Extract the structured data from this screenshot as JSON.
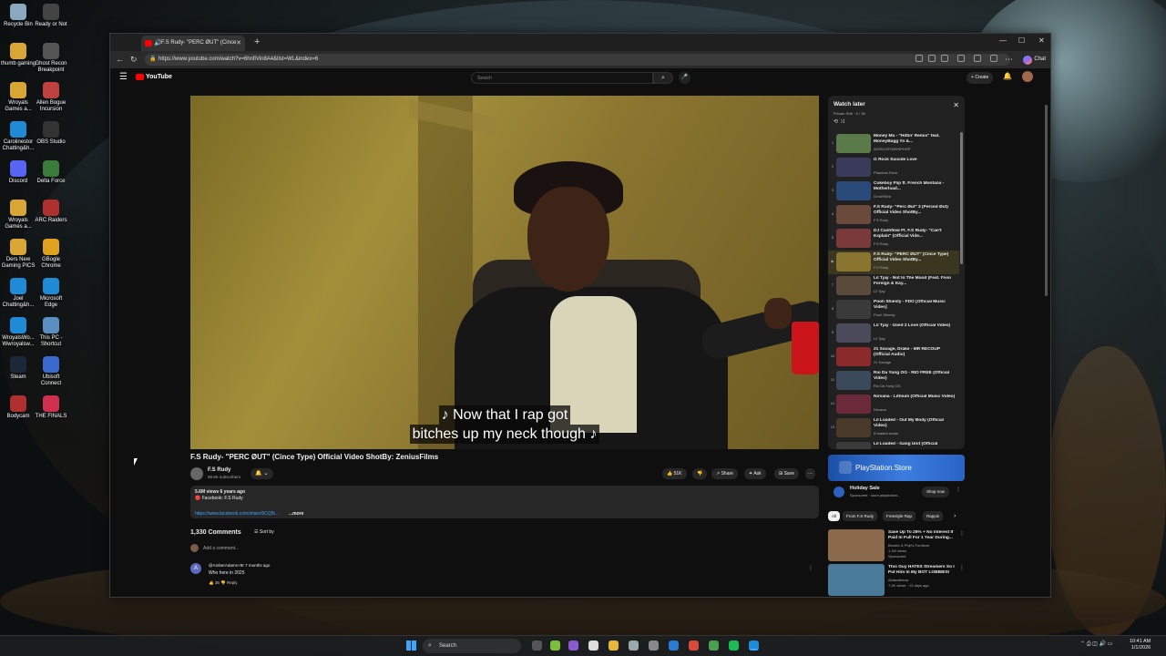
{
  "desktop": {
    "icons": [
      {
        "label": "Recycle Bin",
        "color": "#8aa8c0"
      },
      {
        "label": "Ready or Not",
        "color": "#444"
      },
      {
        "label": "thumb gaming",
        "color": "#d9a534"
      },
      {
        "label": "Ghost Recon Breakpoint",
        "color": "#555"
      },
      {
        "label": "Wroyals Games a...",
        "color": "#d9a534"
      },
      {
        "label": "Allen Bogue Incursion",
        "color": "#c04040"
      },
      {
        "label": "Carolinestor Chatting&h...",
        "color": "#1f8bd6"
      },
      {
        "label": "OBS Studio",
        "color": "#333"
      },
      {
        "label": "Discord",
        "color": "#5865f2"
      },
      {
        "label": "Delta Force",
        "color": "#3a7a3a"
      },
      {
        "label": "Wroyals Games a...",
        "color": "#d9a534"
      },
      {
        "label": "ARC Raiders",
        "color": "#b03030"
      },
      {
        "label": "Ders New Gaming PICS",
        "color": "#d9a534"
      },
      {
        "label": "GBogle Chrome",
        "color": "#e0a020"
      },
      {
        "label": "Joel Chatting&h...",
        "color": "#1f8bd6"
      },
      {
        "label": "Microsoft Edge",
        "color": "#1f8bd6"
      },
      {
        "label": "WroyalsWo... Wwroyalsw...",
        "color": "#1f8bd6"
      },
      {
        "label": "This PC - Shortcut",
        "color": "#5a8fc0"
      },
      {
        "label": "Steam",
        "color": "#1b2838"
      },
      {
        "label": "Ubisoft Connect",
        "color": "#3a6ad0"
      },
      {
        "label": "Bodycam",
        "color": "#b03030"
      },
      {
        "label": "THE FINALS",
        "color": "#d03050"
      }
    ]
  },
  "browser": {
    "tab_title": "F.S Rudy- \"PERC ØUT\" (Cince",
    "url": "https://www.youtube.com/watch?v=6hnfiVin8A4&list=WL&index=6",
    "chat_label": "Chat",
    "new_tab": "+",
    "minimize": "—",
    "maximize": "☐",
    "close": "✕"
  },
  "youtube": {
    "logo": "YouTube",
    "search_placeholder": "Search",
    "create_label": "Create",
    "video": {
      "caption_line1": "♪ Now that I rap got",
      "caption_line2": "bitches up my neck though ♪",
      "title": "F.S Rudy- \"PERC ØUT\" (Cince Type) Official Video ShotBy: ZeniusFilms",
      "channel": "F.S Rudy",
      "subscribers": "59.6K subscribers",
      "likes": "51K",
      "share": "Share",
      "ask": "Ask",
      "save": "Save",
      "views": "5.6M views  6 years ago",
      "desc_line": "Facebook: F.S Rudy",
      "desc_link": "https://www.facebook.com/share/5CQ5t...",
      "more": "...more"
    },
    "comments": {
      "count": "1,330 Comments",
      "sort": "Sort by",
      "add_placeholder": "Add a comment...",
      "items": [
        {
          "avatar": "A",
          "author": "@AmberAdams-r9r  7 months ago",
          "text": "Who here in 2025",
          "likes": "35",
          "reply": "Reply"
        }
      ]
    },
    "playlist": {
      "title": "Watch later",
      "subtitle": "Private  Shill · 6 / 36",
      "close": "✕",
      "items": [
        {
          "idx": "1",
          "title": "Money Mu - \"Hittin' Remix\" feat. MoneyBagg Yo &...",
          "channel": "WORLDSTARHIPHOP",
          "color": "#5a7a4a"
        },
        {
          "idx": "2",
          "title": "G Rock Suicide Love",
          "channel": "Phantom Rock",
          "color": "#3a3a5a"
        },
        {
          "idx": "3",
          "title": "Cokeboy Flip ft. French Montana - Motherload...",
          "channel": "GrndHStre",
          "color": "#2a4a7a"
        },
        {
          "idx": "4",
          "title": "F.S Rudy- \"Perc Øut\" 3 (Perced Øut) Official Video ShotBy...",
          "channel": "F.S Rudy",
          "color": "#6a4a3a"
        },
        {
          "idx": "5",
          "title": "DJ Cashflow Ft. F.S Rudy- \"Can't Explain\" (Official Vide...",
          "channel": "F.S Rudy",
          "color": "#7a3a3a"
        },
        {
          "idx": "▶",
          "title": "F.S Rudy- \"PERC ØUT\" (Cince Type) Official Video ShotBy...",
          "channel": "F.S Rudy",
          "color": "#8a7530",
          "active": true
        },
        {
          "idx": "7",
          "title": "Lil Tjay - Not In The Mood (Feat. Fivio Foreign & Kay...",
          "channel": "Lil Tjay",
          "color": "#5a4a3a"
        },
        {
          "idx": "8",
          "title": "Pooh Shiesty - FDO [Official Music Video]",
          "channel": "Pooh Shiesty",
          "color": "#3a3a3a"
        },
        {
          "idx": "9",
          "title": "Lil Tjay - Used 2 Love (Official Video)",
          "channel": "Lil Tjay",
          "color": "#4a4a5a"
        },
        {
          "idx": "10",
          "title": "21 Savage, Drake - MR RECOUP (Official Audio)",
          "channel": "21 Savage",
          "color": "#8a2a2a"
        },
        {
          "idx": "11",
          "title": "Rio Da Yung OG - RIO FREE (Official Video)",
          "channel": "Rio Da Yung OG",
          "color": "#3a4a5a"
        },
        {
          "idx": "12",
          "title": "Nirvana - Lithium (Official Music Video)",
          "channel": "Nirvana",
          "color": "#6a2a3a"
        },
        {
          "idx": "13",
          "title": "Lil Loaded - Out My Body (Official Video)",
          "channel": "lil loaded music",
          "color": "#4a3a2a"
        },
        {
          "idx": "14",
          "title": "Lil Loaded - Gang Unit (Official",
          "channel": "",
          "color": "#3a3a3a"
        }
      ]
    },
    "ad": {
      "banner": "PlayStation.Store",
      "title": "Holiday Sale",
      "sponsor": "Sponsored · store.playstation...",
      "shop": "Shop now"
    },
    "chips": [
      "All",
      "From F.S Rudy",
      "Freestyle Rap",
      "Rappin"
    ],
    "recommendations": [
      {
        "title": "Save Up To 25% + No Interest If Paid In Full For 1 Year During...",
        "channel": "Bender & Phyl's Furniture",
        "views": "1.1M views",
        "extra": "Sponsored",
        "color": "#8a6a4a"
      },
      {
        "title": "This Guy HATES Streamers So I Put Him In My BOT LOBBIES!",
        "channel": "Aidandlesna",
        "views": "7.2K views · 13 days ago",
        "extra": "",
        "color": "#4a7a9a"
      }
    ]
  },
  "taskbar": {
    "search": "Search",
    "time": "10:41 AM",
    "date": "1/1/2026"
  }
}
